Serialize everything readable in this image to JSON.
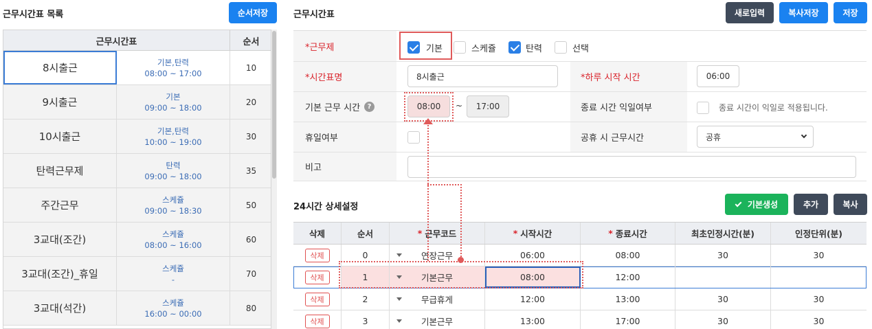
{
  "left": {
    "title": "근무시간표 목록",
    "save_order_label": "순서저장",
    "col_schedule": "근무시간표",
    "col_order": "순서",
    "rows": [
      {
        "name": "8시출근",
        "type": "기본,탄력",
        "time": "08:00 ~ 17:00",
        "order": "10"
      },
      {
        "name": "9시출근",
        "type": "기본",
        "time": "09:00 ~ 18:00",
        "order": "20"
      },
      {
        "name": "10시출근",
        "type": "기본,탄력",
        "time": "10:00 ~ 19:00",
        "order": "30"
      },
      {
        "name": "탄력근무제",
        "type": "탄력",
        "time": "09:00 ~ 18:00",
        "order": "35"
      },
      {
        "name": "주간근무",
        "type": "스케쥴",
        "time": "09:00 ~ 18:30",
        "order": "50"
      },
      {
        "name": "3교대(조간)",
        "type": "스케쥴",
        "time": "08:00 ~ 16:00",
        "order": "60"
      },
      {
        "name": "3교대(조간)_휴일",
        "type": "스케쥴",
        "time": "-",
        "order": "70"
      },
      {
        "name": "3교대(석간)",
        "type": "스케쥴",
        "time": "16:00 ~ 00:00",
        "order": "80"
      }
    ]
  },
  "right": {
    "title": "근무시간표",
    "new_label": "새로입력",
    "copy_save_label": "복사저장",
    "save_label": "저장"
  },
  "form": {
    "work_system_label": "*근무제",
    "options": [
      {
        "label": "기본",
        "checked": true
      },
      {
        "label": "스케쥴",
        "checked": false
      },
      {
        "label": "탄력",
        "checked": true
      },
      {
        "label": "선택",
        "checked": false
      }
    ],
    "schedule_name_label": "*시간표명",
    "schedule_name_value": "8시출근",
    "day_start_label": "*하루 시작 시간",
    "day_start_value": "06:00",
    "base_time_label": "기본 근무 시간",
    "base_start": "08:00",
    "tilde": "~",
    "base_end": "17:00",
    "end_next_day_label": "종료 시간 익일여부",
    "end_next_day_text": "종료 시간이 익일로 적용됩니다.",
    "holiday_label": "휴일여부",
    "public_holiday_label": "공휴 시 근무시간",
    "public_holiday_value": "공휴",
    "note_label": "비고",
    "note_value": ""
  },
  "detail": {
    "title": "24시간 상세설정",
    "generate_label": "기본생성",
    "add_label": "추가",
    "copy_label": "복사",
    "headers": [
      "삭제",
      "순서",
      "근무코드",
      "시작시간",
      "종료시간",
      "최초인정시간(분)",
      "인정단위(분)"
    ],
    "rows": [
      {
        "del": "삭제",
        "order": "0",
        "code": "연장근무",
        "start": "06:00",
        "end": "08:00",
        "first": "30",
        "unit": "30"
      },
      {
        "del": "삭제",
        "order": "1",
        "code": "기본근무",
        "start": "08:00",
        "end": "12:00",
        "first": "",
        "unit": ""
      },
      {
        "del": "삭제",
        "order": "2",
        "code": "무급휴게",
        "start": "12:00",
        "end": "13:00",
        "first": "30",
        "unit": "30"
      },
      {
        "del": "삭제",
        "order": "3",
        "code": "기본근무",
        "start": "13:00",
        "end": "17:00",
        "first": "30",
        "unit": "30"
      }
    ]
  },
  "colors": {
    "accent": "#1a82f0",
    "dark_button": "#3f4a5a",
    "green_button": "#1bb35b",
    "highlight_red": "#e05a5a",
    "highlight_fill": "#fbe0e0"
  }
}
